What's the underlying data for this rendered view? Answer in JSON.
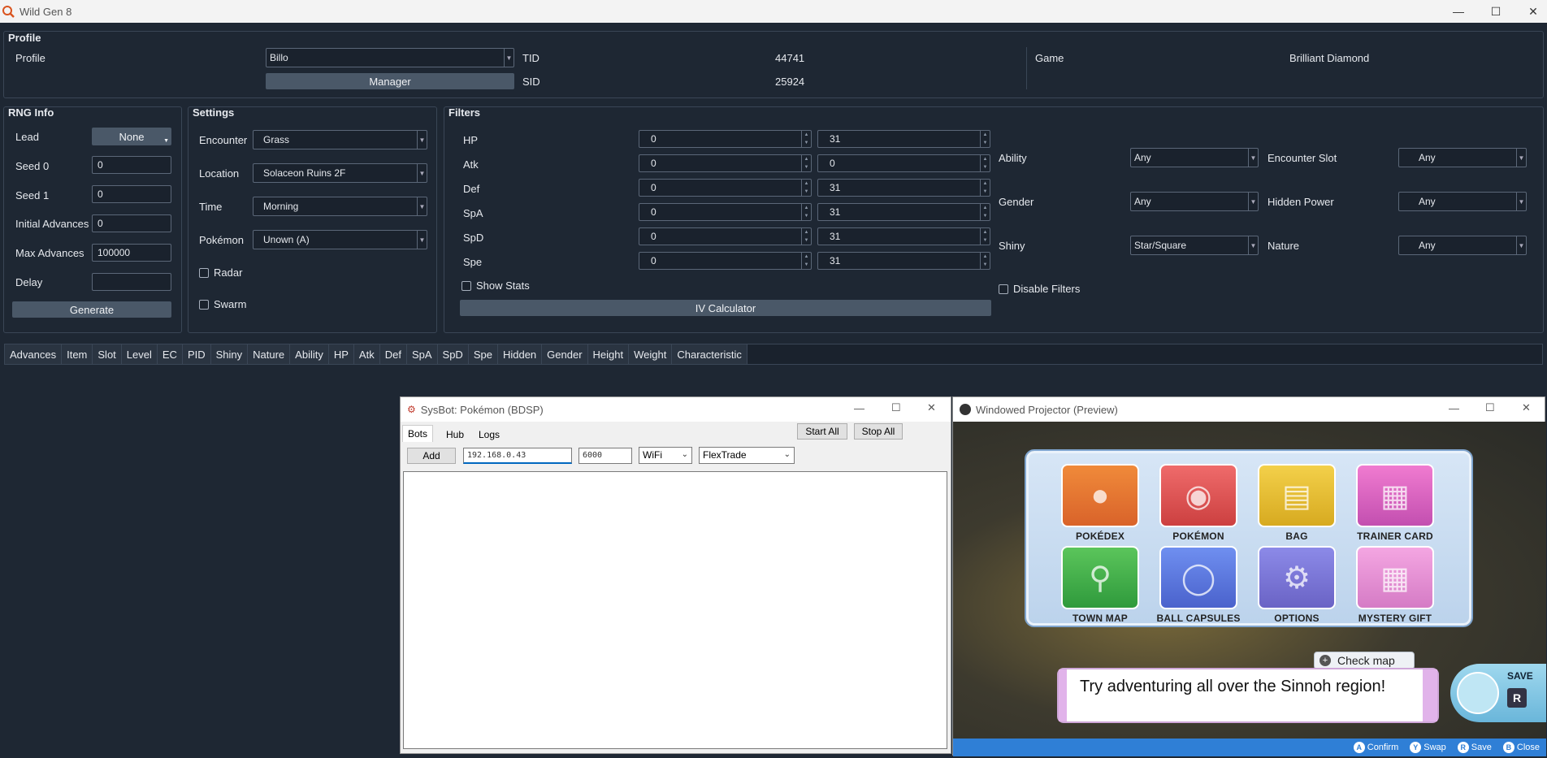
{
  "app": {
    "title": "Wild Gen 8"
  },
  "profile": {
    "section_title": "Profile",
    "profile_label": "Profile",
    "profile_value": "Billo",
    "manager_button": "Manager",
    "tid_label": "TID",
    "tid_value": "44741",
    "sid_label": "SID",
    "sid_value": "25924",
    "game_label": "Game",
    "game_value": "Brilliant Diamond"
  },
  "rng": {
    "section_title": "RNG Info",
    "lead_label": "Lead",
    "lead_value": "None",
    "seed0_label": "Seed 0",
    "seed0_value": "0",
    "seed1_label": "Seed 1",
    "seed1_value": "0",
    "initial_label": "Initial Advances",
    "initial_value": "0",
    "max_label": "Max Advances",
    "max_value": "100000",
    "delay_label": "Delay",
    "delay_value": "",
    "generate_button": "Generate"
  },
  "settings": {
    "section_title": "Settings",
    "encounter_label": "Encounter",
    "encounter_value": "Grass",
    "location_label": "Location",
    "location_value": "Solaceon Ruins 2F",
    "time_label": "Time",
    "time_value": "Morning",
    "pokemon_label": "Pokémon",
    "pokemon_value": "Unown (A)",
    "radar_label": "Radar",
    "swarm_label": "Swarm"
  },
  "filters": {
    "section_title": "Filters",
    "stats": [
      {
        "label": "HP",
        "min": "0",
        "max": "31"
      },
      {
        "label": "Atk",
        "min": "0",
        "max": "0"
      },
      {
        "label": "Def",
        "min": "0",
        "max": "31"
      },
      {
        "label": "SpA",
        "min": "0",
        "max": "31"
      },
      {
        "label": "SpD",
        "min": "0",
        "max": "31"
      },
      {
        "label": "Spe",
        "min": "0",
        "max": "31"
      }
    ],
    "show_stats_label": "Show Stats",
    "iv_calc_button": "IV Calculator",
    "ability_label": "Ability",
    "ability_value": "Any",
    "gender_label": "Gender",
    "gender_value": "Any",
    "shiny_label": "Shiny",
    "shiny_value": "Star/Square",
    "encounter_slot_label": "Encounter Slot",
    "encounter_slot_value": "Any",
    "hidden_power_label": "Hidden Power",
    "hidden_power_value": "Any",
    "nature_label": "Nature",
    "nature_value": "Any",
    "disable_filters_label": "Disable Filters"
  },
  "results": {
    "columns": [
      "Advances",
      "Item",
      "Slot",
      "Level",
      "EC",
      "PID",
      "Shiny",
      "Nature",
      "Ability",
      "HP",
      "Atk",
      "Def",
      "SpA",
      "SpD",
      "Spe",
      "Hidden",
      "Gender",
      "Height",
      "Weight",
      "Characteristic"
    ]
  },
  "sysbot": {
    "title": "SysBot: Pokémon (BDSP)",
    "tabs": [
      "Bots",
      "Hub",
      "Logs"
    ],
    "start_all": "Start All",
    "stop_all": "Stop All",
    "add_button": "Add",
    "ip_value": "192.168.0.43",
    "port_value": "6000",
    "protocol_value": "WiFi",
    "routine_value": "FlexTrade"
  },
  "projector": {
    "title": "Windowed Projector (Preview)",
    "menu_items": [
      "POKÉDEX",
      "POKÉMON",
      "BAG",
      "TRAINER CARD",
      "TOWN MAP",
      "BALL CAPSULES",
      "OPTIONS",
      "MYSTERY GIFT"
    ],
    "check_map": "Check map",
    "dialog": "Try adventuring all over the Sinnoh region!",
    "save_label": "SAVE",
    "save_key": "R",
    "hints": [
      {
        "key": "A",
        "label": "Confirm"
      },
      {
        "key": "Y",
        "label": "Swap"
      },
      {
        "key": "R",
        "label": "Save"
      },
      {
        "key": "B",
        "label": "Close"
      }
    ]
  }
}
